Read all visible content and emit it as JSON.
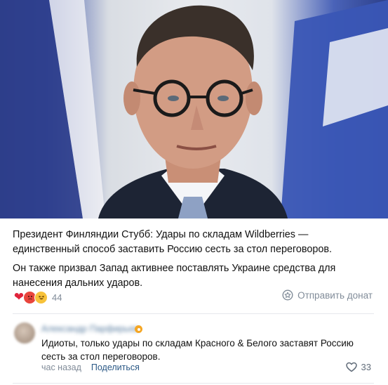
{
  "post": {
    "image_alt": "photo",
    "paragraph1": "Президент Финляндии Стубб: Удары по складам Wildberries — единственный способ заставить Россию сесть за стол переговоров.",
    "paragraph2": "Он также призвал Запад активнее поставлять Украине средства для нанесения дальних ударов.",
    "reactions": {
      "icons": [
        "heart-icon",
        "angry-face-icon",
        "laughing-face-icon"
      ],
      "count": "44"
    },
    "donate_label": "Отправить донат"
  },
  "comment": {
    "author": "Александр Парфирьев",
    "text": "Идиоты, только удары по складам Красного & Белого заставят Россию сесть за стол переговоров.",
    "time": "час назад",
    "share_label": "Поделиться",
    "likes": "33"
  }
}
